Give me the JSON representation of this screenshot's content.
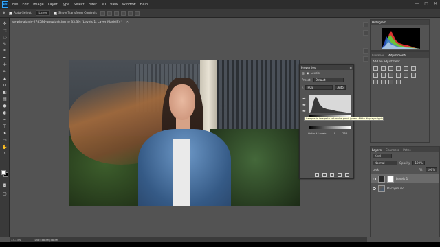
{
  "menu": {
    "app_icon": "Ps",
    "items": [
      "File",
      "Edit",
      "Image",
      "Layer",
      "Type",
      "Select",
      "Filter",
      "3D",
      "View",
      "Window",
      "Help"
    ],
    "window_controls": [
      "—",
      "□",
      "✕"
    ]
  },
  "options": {
    "auto_select": "Auto-Select:",
    "layer_value": "Layer",
    "show_transform": "Show Transform Controls"
  },
  "document": {
    "tab_title": "selwin-alanis-278584-unsplash.jpg @ 33.3% (Levels 1, Layer Mask/8) *",
    "close": "✕"
  },
  "histogram": {
    "tab": "Histogram"
  },
  "adjustments": {
    "tabs": [
      "Libraries",
      "Adjustments"
    ],
    "heading": "Add an adjustment"
  },
  "properties": {
    "title": "Properties",
    "sub": "Levels",
    "preset_label": "Preset:",
    "preset_value": "Default",
    "channel": "RGB",
    "auto": "Auto",
    "input_values": [
      "0",
      "1.00",
      "255"
    ],
    "output_label": "Output Levels:",
    "output_values": [
      "0",
      "255"
    ],
    "tooltip": "Sample in image to set white point (press Alt to display clipping preview)"
  },
  "layers": {
    "tabs": [
      "Layers",
      "Channels",
      "Paths"
    ],
    "kind": "Kind",
    "blend": "Normal",
    "opacity_label": "Opacity:",
    "opacity": "100%",
    "lock_label": "Lock:",
    "fill_label": "Fill:",
    "fill": "100%",
    "items": [
      {
        "name": "Levels 1",
        "selected": true
      },
      {
        "name": "Background",
        "selected": false
      }
    ]
  },
  "status": {
    "zoom": "33.33%",
    "doc": "Doc: 48.8M/48.8M"
  }
}
